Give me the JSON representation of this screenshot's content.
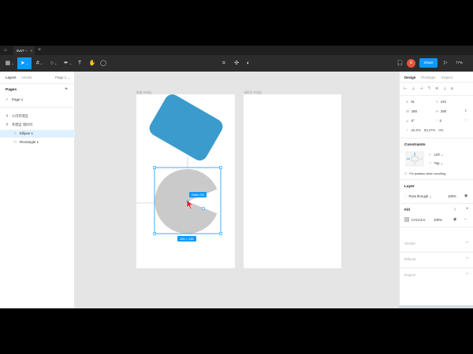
{
  "tabbar": {
    "tab_label": "0vs7 –",
    "tab_close": "×",
    "new_tab": "+"
  },
  "toolbar": {
    "avatar_initial": "U",
    "share_label": "Share",
    "zoom": "77%"
  },
  "left_panel": {
    "tabs": [
      "Layers",
      "Assets",
      "Page 1 ⌄"
    ],
    "pages_title": "Pages",
    "pages_add": "+",
    "page_item": "Page 1",
    "layers": [
      {
        "icon": "#",
        "label": "스리프레임"
      },
      {
        "icon": "#",
        "label": "프레임 레이어"
      },
      {
        "icon": "○",
        "label": "Ellipse 1"
      },
      {
        "icon": "□",
        "label": "Rectangle 1"
      }
    ]
  },
  "canvas": {
    "frame1_label": "원래 프레임",
    "frame2_label": "새로운 프레임",
    "radius_badge": "Ratio 0%",
    "size_badge": "280 × 280",
    "colors": {
      "rectangle": "#3b9bcd",
      "ellipse": "#cacaca",
      "selection": "#0d99ff"
    }
  },
  "right_panel": {
    "tabs": [
      "Design",
      "Prototype",
      "Inspect"
    ],
    "x": "76",
    "y": "370",
    "w": "280",
    "h": "280",
    "rotation": "0°",
    "corner": "0",
    "arc_start": "-25.0%",
    "arc_sweep": "83.37%",
    "arc_ratio": "0%",
    "constraints_title": "Constraints",
    "constraint_h": "Left",
    "constraint_v": "Top",
    "fix_scroll": "Fix position when scrolling",
    "layer_title": "Layer",
    "blend": "Pass through",
    "layer_opacity": "100%",
    "fill_title": "Fill",
    "fill_hex": "CACACA",
    "fill_opacity": "100%",
    "fill_color": "#cacaca",
    "stroke_title": "Stroke",
    "effects_title": "Effects",
    "export_title": "Export"
  }
}
